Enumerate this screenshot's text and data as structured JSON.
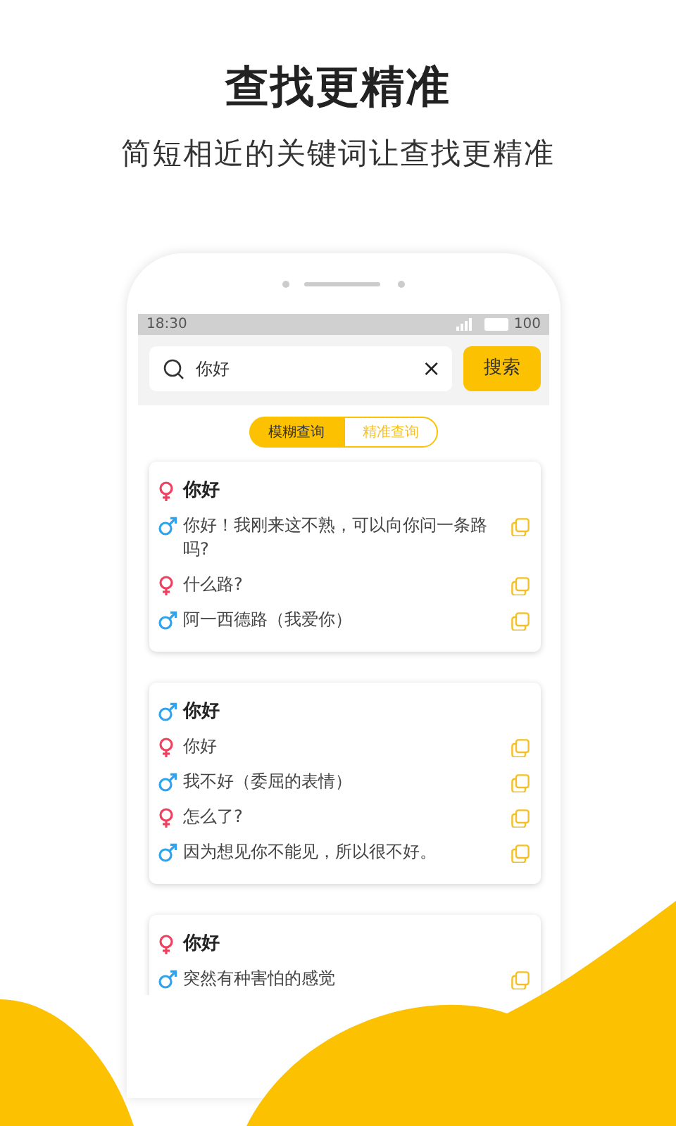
{
  "headline": "查找更精准",
  "subtitle": "简短相近的关键词让查找更精准",
  "status_bar": {
    "time": "18:30",
    "battery": "100"
  },
  "search": {
    "value": "你好",
    "clear": "×",
    "button": "搜索"
  },
  "modes": [
    {
      "label": "模糊查询",
      "selected": true
    },
    {
      "label": "精准查询",
      "selected": false
    }
  ],
  "results": [
    {
      "title": {
        "kind": "female",
        "text": "你好"
      },
      "lines": [
        {
          "kind": "male",
          "text": "你好！我刚来这不熟，可以向你问一条路吗?"
        },
        {
          "kind": "female",
          "text": "什么路?"
        },
        {
          "kind": "male",
          "text": "阿一西德路（我爱你）"
        }
      ]
    },
    {
      "title": {
        "kind": "male",
        "text": "你好"
      },
      "lines": [
        {
          "kind": "female",
          "text": "你好"
        },
        {
          "kind": "male",
          "text": "我不好（委屈的表情）"
        },
        {
          "kind": "female",
          "text": "怎么了?"
        },
        {
          "kind": "male",
          "text": "因为想见你不能见，所以很不好。"
        }
      ]
    },
    {
      "title": {
        "kind": "female",
        "text": "你好"
      },
      "lines": [
        {
          "kind": "male",
          "text": "突然有种害怕的感觉"
        }
      ]
    }
  ]
}
